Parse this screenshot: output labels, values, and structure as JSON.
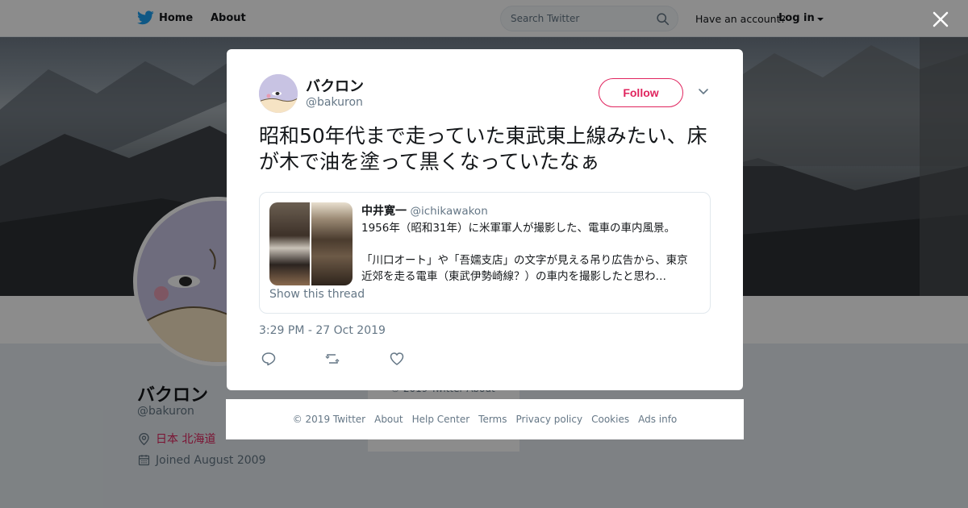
{
  "topbar": {
    "home_label": "Home",
    "about_label": "About",
    "search_placeholder": "Search Twitter",
    "account_question": "Have an account?",
    "login_label": "Log in"
  },
  "profile": {
    "name": "バクロン",
    "handle": "@bakuron",
    "location": "日本 北海道",
    "joined": "Joined August 2009"
  },
  "background_footer": "© 2019 Twitter  About",
  "tweet": {
    "author_name": "バクロン",
    "author_handle": "@bakuron",
    "follow_label": "Follow",
    "text": "昭和50年代まで走っていた東武東上線みたい、床が木で油を塗って黒くなっていたなぁ",
    "timestamp": "3:29 PM - 27 Oct 2019"
  },
  "quote": {
    "author_name": "中井寛一",
    "author_handle": "@ichikawakon",
    "line1": "1956年（昭和31年）に米軍軍人が撮影した、電車の車内風景。",
    "line2": "「川口オート」や「吾嬬支店」の文字が見える吊り広告から、東京",
    "line3": "近郊を走る電車（東武伊勢崎線？）の車内を撮影したと思わ…",
    "show_thread": "Show this thread"
  },
  "footer_links": {
    "copyright": "© 2019 Twitter",
    "about": "About",
    "help": "Help Center",
    "terms": "Terms",
    "privacy": "Privacy policy",
    "cookies": "Cookies",
    "ads": "Ads info"
  },
  "colors": {
    "accent": "#e0245e",
    "twitter_blue": "#1da1f2",
    "muted_text": "#657786"
  }
}
